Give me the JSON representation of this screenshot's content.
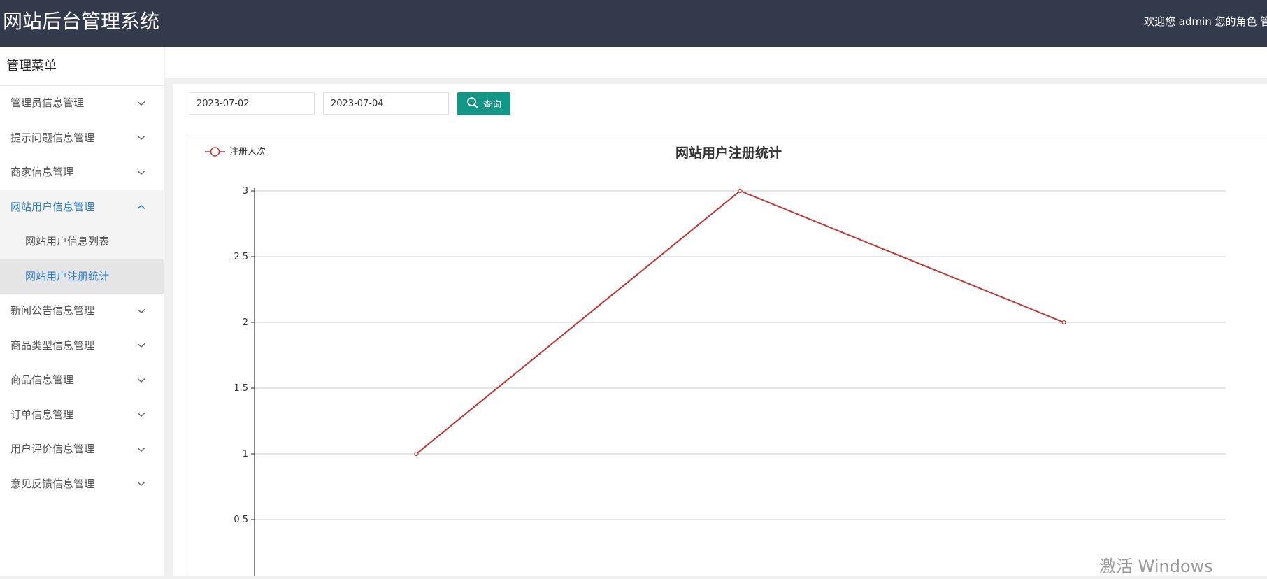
{
  "header": {
    "app_title": "网站后台管理系统",
    "welcome_text": "欢迎您 admin 您的角色 管"
  },
  "sidebar": {
    "title": "管理菜单",
    "items": [
      {
        "label": "管理员信息管理"
      },
      {
        "label": "提示问题信息管理"
      },
      {
        "label": "商家信息管理"
      },
      {
        "label": "网站用户信息管理",
        "children": [
          {
            "label": "网站用户信息列表"
          },
          {
            "label": "网站用户注册统计"
          }
        ]
      },
      {
        "label": "新闻公告信息管理"
      },
      {
        "label": "商品类型信息管理"
      },
      {
        "label": "商品信息管理"
      },
      {
        "label": "订单信息管理"
      },
      {
        "label": "用户评价信息管理"
      },
      {
        "label": "意见反馈信息管理"
      }
    ]
  },
  "filters": {
    "start_date": "2023-07-02",
    "end_date": "2023-07-04",
    "query_label": "查询"
  },
  "colors": {
    "header_bg": "#323a4b",
    "accent": "#129686",
    "active_link": "#2b7cd3",
    "series": "#c23531"
  },
  "icons": {
    "expand": "chevron-down-icon",
    "collapse": "chevron-up-icon",
    "search": "search-icon"
  },
  "chart_data": {
    "type": "line",
    "title": "网站用户注册统计",
    "series": [
      {
        "name": "注册人次",
        "values": [
          1,
          3,
          2
        ]
      }
    ],
    "ylim": [
      0,
      3
    ],
    "yticks": [
      0.5,
      1,
      1.5,
      2,
      2.5,
      3
    ],
    "ytick_labels": [
      "0.5",
      "1",
      "1.5",
      "2",
      "2.5",
      "3"
    ],
    "grid": true,
    "legend_position": "top-left"
  },
  "watermark": "激活 Windows"
}
